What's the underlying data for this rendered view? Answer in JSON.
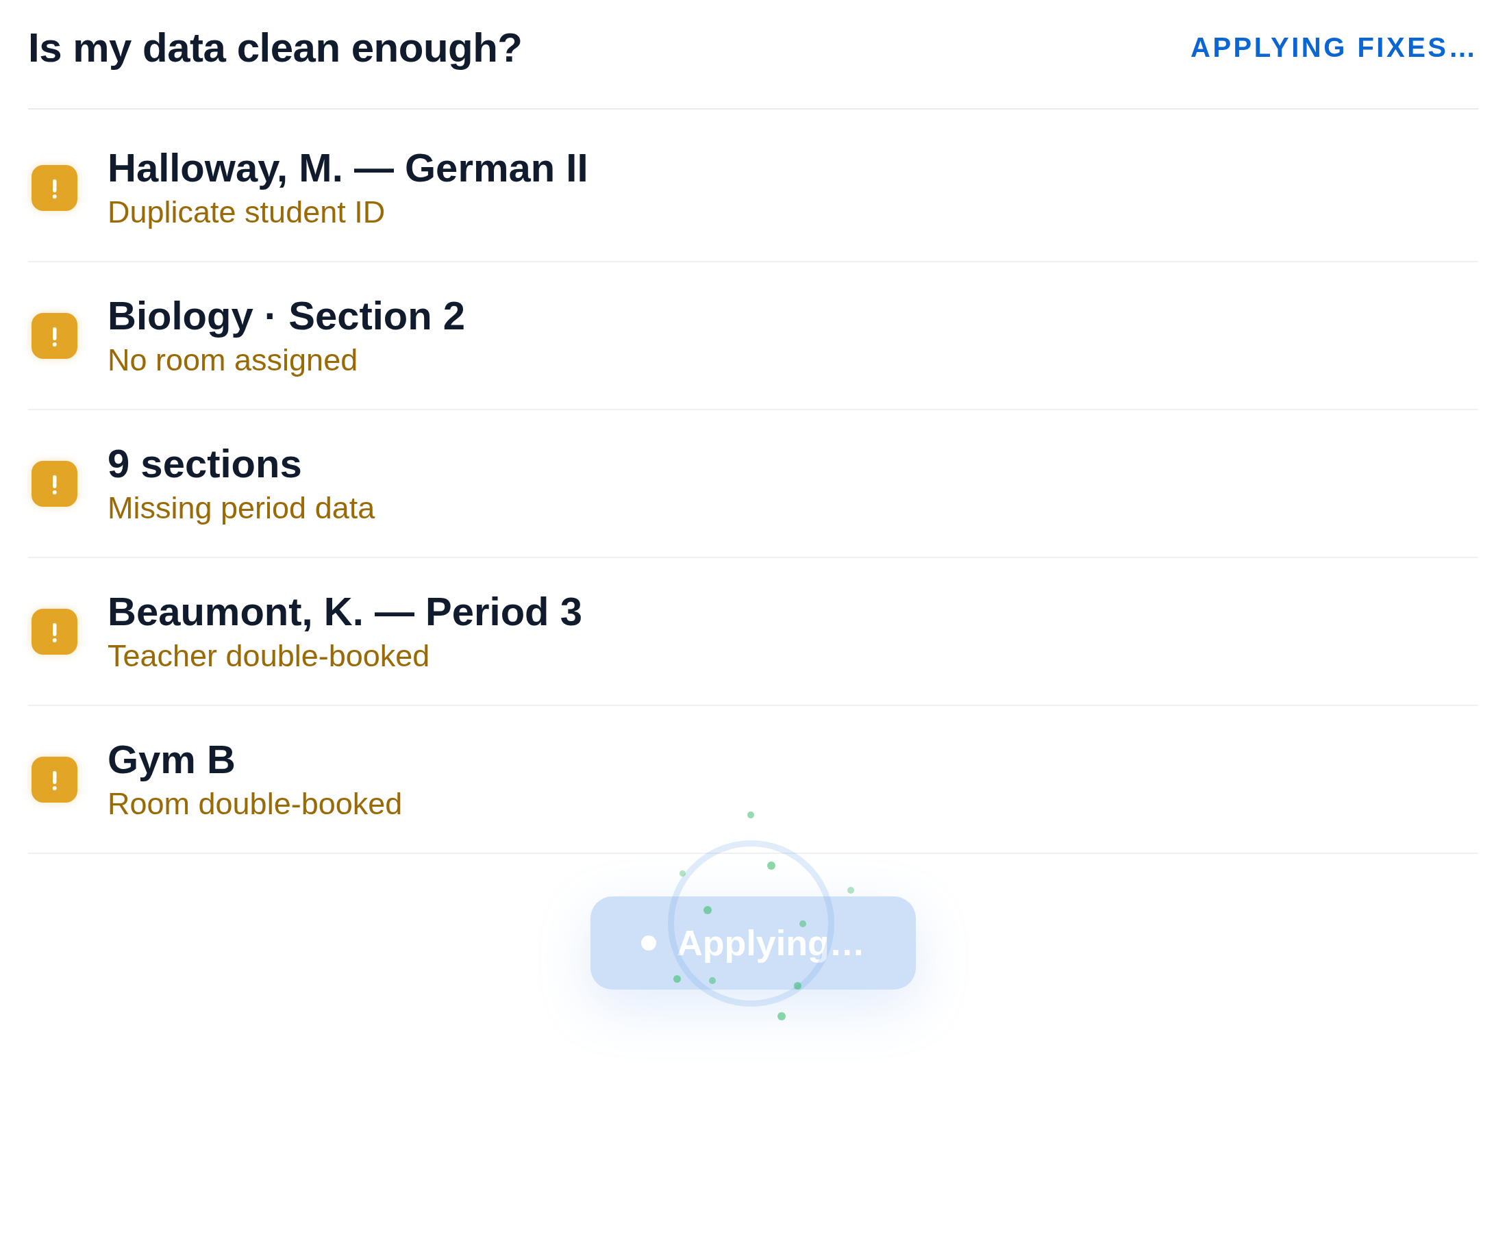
{
  "header": {
    "title": "Is my data clean enough?",
    "status": "APPLYING FIXES…"
  },
  "issues": [
    {
      "title": "Halloway, M. — German II",
      "problem": "Duplicate student ID"
    },
    {
      "title": "Biology · Section 2",
      "problem": "No room assigned"
    },
    {
      "title": "9 sections",
      "problem": "Missing period data"
    },
    {
      "title": "Beaumont, K. — Period 3",
      "problem": "Teacher double-booked"
    },
    {
      "title": "Gym B",
      "problem": "Room double-booked"
    }
  ],
  "action_button": {
    "label": "Applying…",
    "disabled": true
  }
}
